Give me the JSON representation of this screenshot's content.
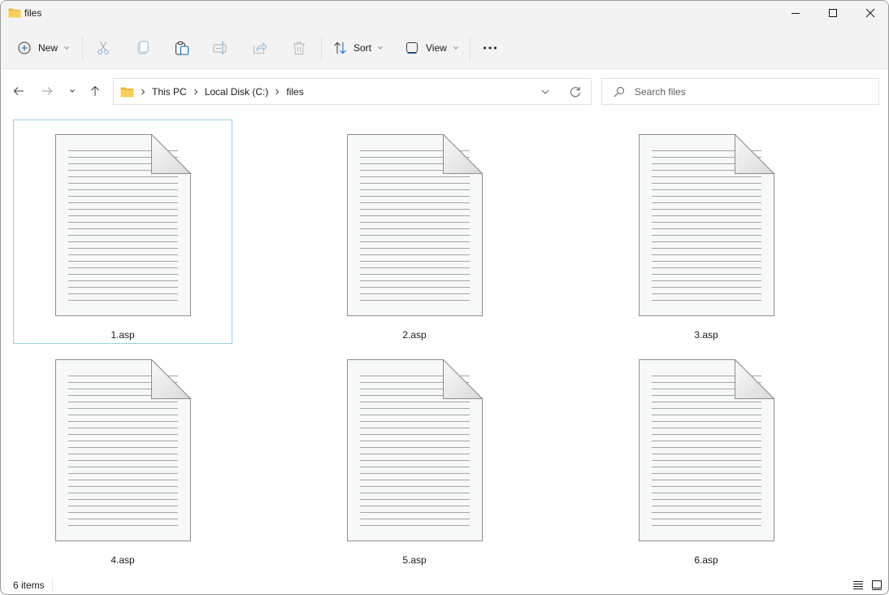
{
  "window": {
    "title": "files",
    "controls": {
      "minimize": "minimize",
      "maximize": "maximize",
      "close": "close"
    }
  },
  "toolbar": {
    "new_label": "New",
    "sort_label": "Sort",
    "view_label": "View",
    "icons": [
      "new-icon",
      "cut-icon",
      "copy-icon",
      "paste-icon",
      "rename-icon",
      "share-icon",
      "delete-icon",
      "sort-icon",
      "view-icon",
      "more-icon"
    ]
  },
  "navigation": {
    "breadcrumb": [
      "This PC",
      "Local Disk (C:)",
      "files"
    ]
  },
  "search": {
    "placeholder": "Search files",
    "value": ""
  },
  "files": [
    {
      "name": "1.asp",
      "selected": true
    },
    {
      "name": "2.asp",
      "selected": false
    },
    {
      "name": "3.asp",
      "selected": false
    },
    {
      "name": "4.asp",
      "selected": false
    },
    {
      "name": "5.asp",
      "selected": false
    },
    {
      "name": "6.asp",
      "selected": false
    }
  ],
  "status": {
    "item_count": "6 items"
  },
  "colors": {
    "accent": "#0067c0",
    "folder": "#f6c343",
    "selection_border": "#99d1e5",
    "toolbar_bg": "#f3f3f3"
  }
}
